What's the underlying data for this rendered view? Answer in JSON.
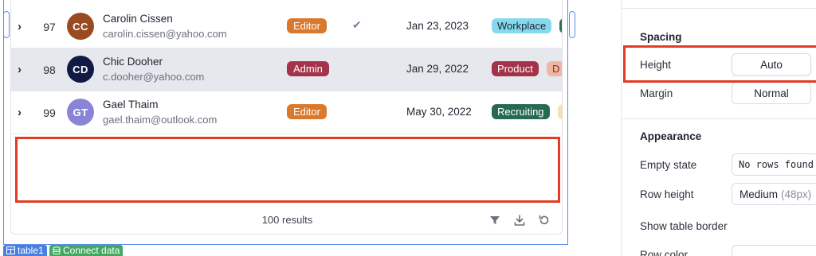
{
  "table": {
    "rows": [
      {
        "id": "97",
        "initials": "CC",
        "avatar_color": "#9a4a1f",
        "name": "Carolin Cissen",
        "email": "carolin.cissen@yahoo.com",
        "role": "Editor",
        "role_color": "#d9792d",
        "verified": true,
        "date": "Jan 23, 2023",
        "tags": [
          {
            "label": "Workplace",
            "bg": "#84d9ee",
            "fg": "#1f2330"
          },
          {
            "label": "",
            "bg": "#2f6e55",
            "fg": "#ffffff"
          }
        ]
      },
      {
        "id": "98",
        "initials": "CD",
        "avatar_color": "#101a44",
        "name": "Chic Dooher",
        "email": "c.dooher@yahoo.com",
        "role": "Admin",
        "role_color": "#a3324a",
        "verified": false,
        "date": "Jan 29, 2022",
        "tags": [
          {
            "label": "Product",
            "bg": "#a3324a",
            "fg": "#ffffff"
          },
          {
            "label": "D",
            "bg": "#f0b6a4",
            "fg": "#8a2f1c"
          }
        ]
      },
      {
        "id": "99",
        "initials": "GT",
        "avatar_color": "#8a84d6",
        "name": "Gael Thaim",
        "email": "gael.thaim@outlook.com",
        "role": "Editor",
        "role_color": "#d9792d",
        "verified": false,
        "date": "May 30, 2022",
        "tags": [
          {
            "label": "Recruiting",
            "bg": "#276a52",
            "fg": "#ffffff"
          },
          {
            "label": "",
            "bg": "#f4e3a6",
            "fg": "#1f2330"
          }
        ]
      }
    ],
    "results": "100 results",
    "footer_icons": [
      "filter-icon",
      "download-icon",
      "refresh-icon"
    ]
  },
  "badges": {
    "component": "table1",
    "connect": "Connect data"
  },
  "panel": {
    "spacing_title": "Spacing",
    "height_label": "Height",
    "height_value": "Auto",
    "margin_label": "Margin",
    "margin_value": "Normal",
    "appearance_title": "Appearance",
    "empty_state_label": "Empty state",
    "empty_state_value": "No rows found",
    "row_height_label": "Row height",
    "row_height_value": "Medium",
    "row_height_hint": "(48px)",
    "show_border_label": "Show table border",
    "row_color_label": "Row color"
  },
  "colors": {
    "selection": "#5b8def",
    "highlight": "#e23d24",
    "row_selected_bg": "#e7e8ee"
  }
}
